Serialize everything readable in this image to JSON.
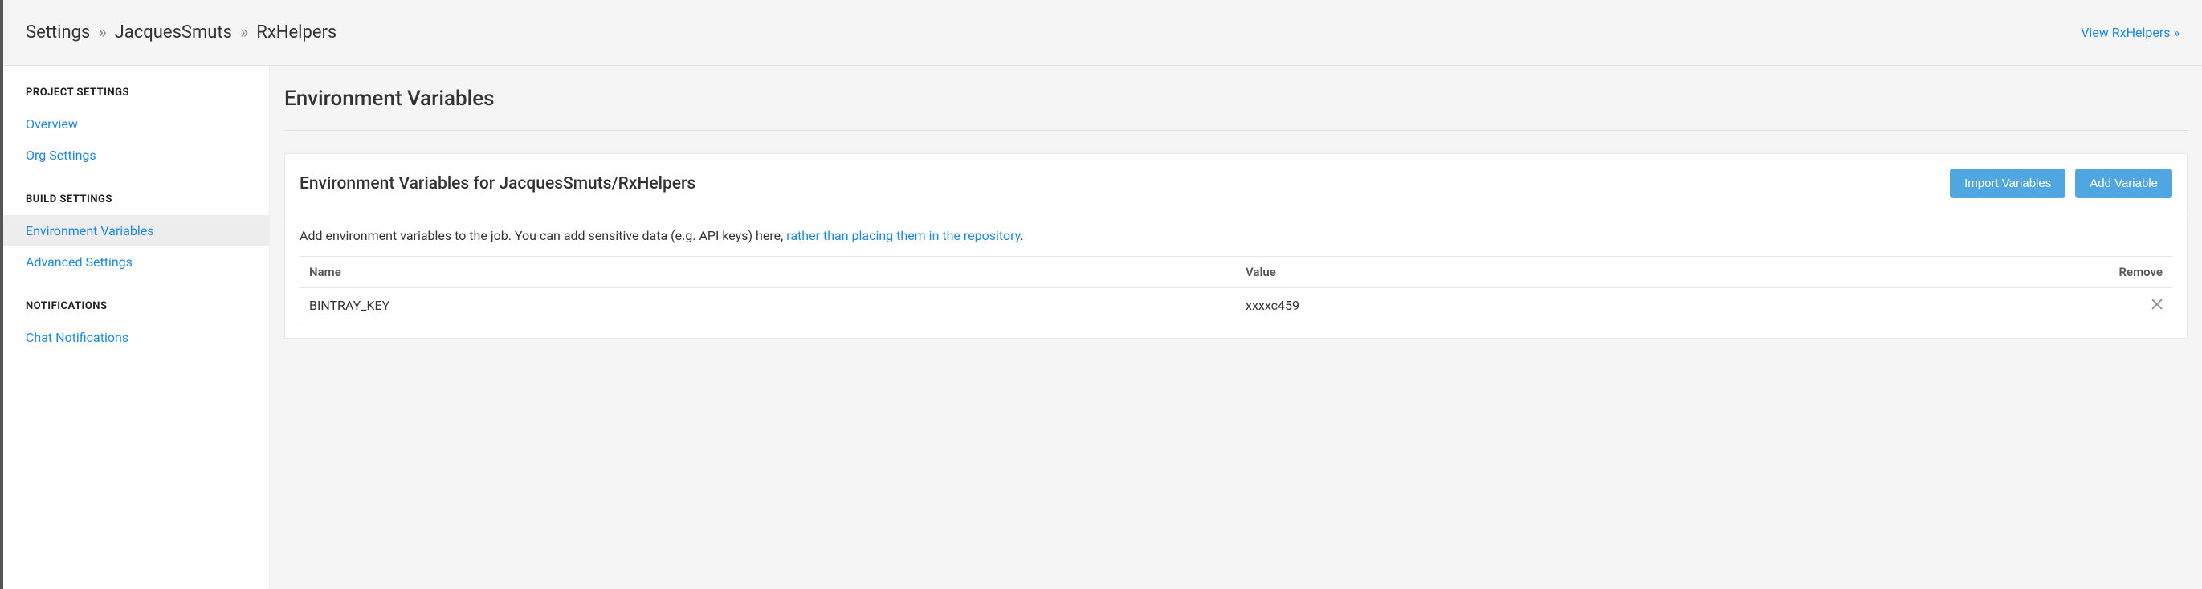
{
  "breadcrumb": {
    "root": "Settings",
    "org": "JacquesSmuts",
    "project": "RxHelpers",
    "view_link": "View RxHelpers »"
  },
  "sidebar": {
    "sections": [
      {
        "title": "PROJECT SETTINGS",
        "items": [
          {
            "label": "Overview",
            "active": false
          },
          {
            "label": "Org Settings",
            "active": false
          }
        ]
      },
      {
        "title": "BUILD SETTINGS",
        "items": [
          {
            "label": "Environment Variables",
            "active": true
          },
          {
            "label": "Advanced Settings",
            "active": false
          }
        ]
      },
      {
        "title": "NOTIFICATIONS",
        "items": [
          {
            "label": "Chat Notifications",
            "active": false
          }
        ]
      }
    ]
  },
  "main": {
    "page_title": "Environment Variables",
    "panel_title": "Environment Variables for JacquesSmuts/RxHelpers",
    "import_btn": "Import Variables",
    "add_btn": "Add Variable",
    "description_prefix": "Add environment variables to the job. You can add sensitive data (e.g. API keys) here, ",
    "description_link": "rather than placing them in the repository",
    "description_suffix": ".",
    "table": {
      "headers": {
        "name": "Name",
        "value": "Value",
        "remove": "Remove"
      },
      "rows": [
        {
          "name": "BINTRAY_KEY",
          "value": "xxxxc459"
        }
      ]
    }
  }
}
